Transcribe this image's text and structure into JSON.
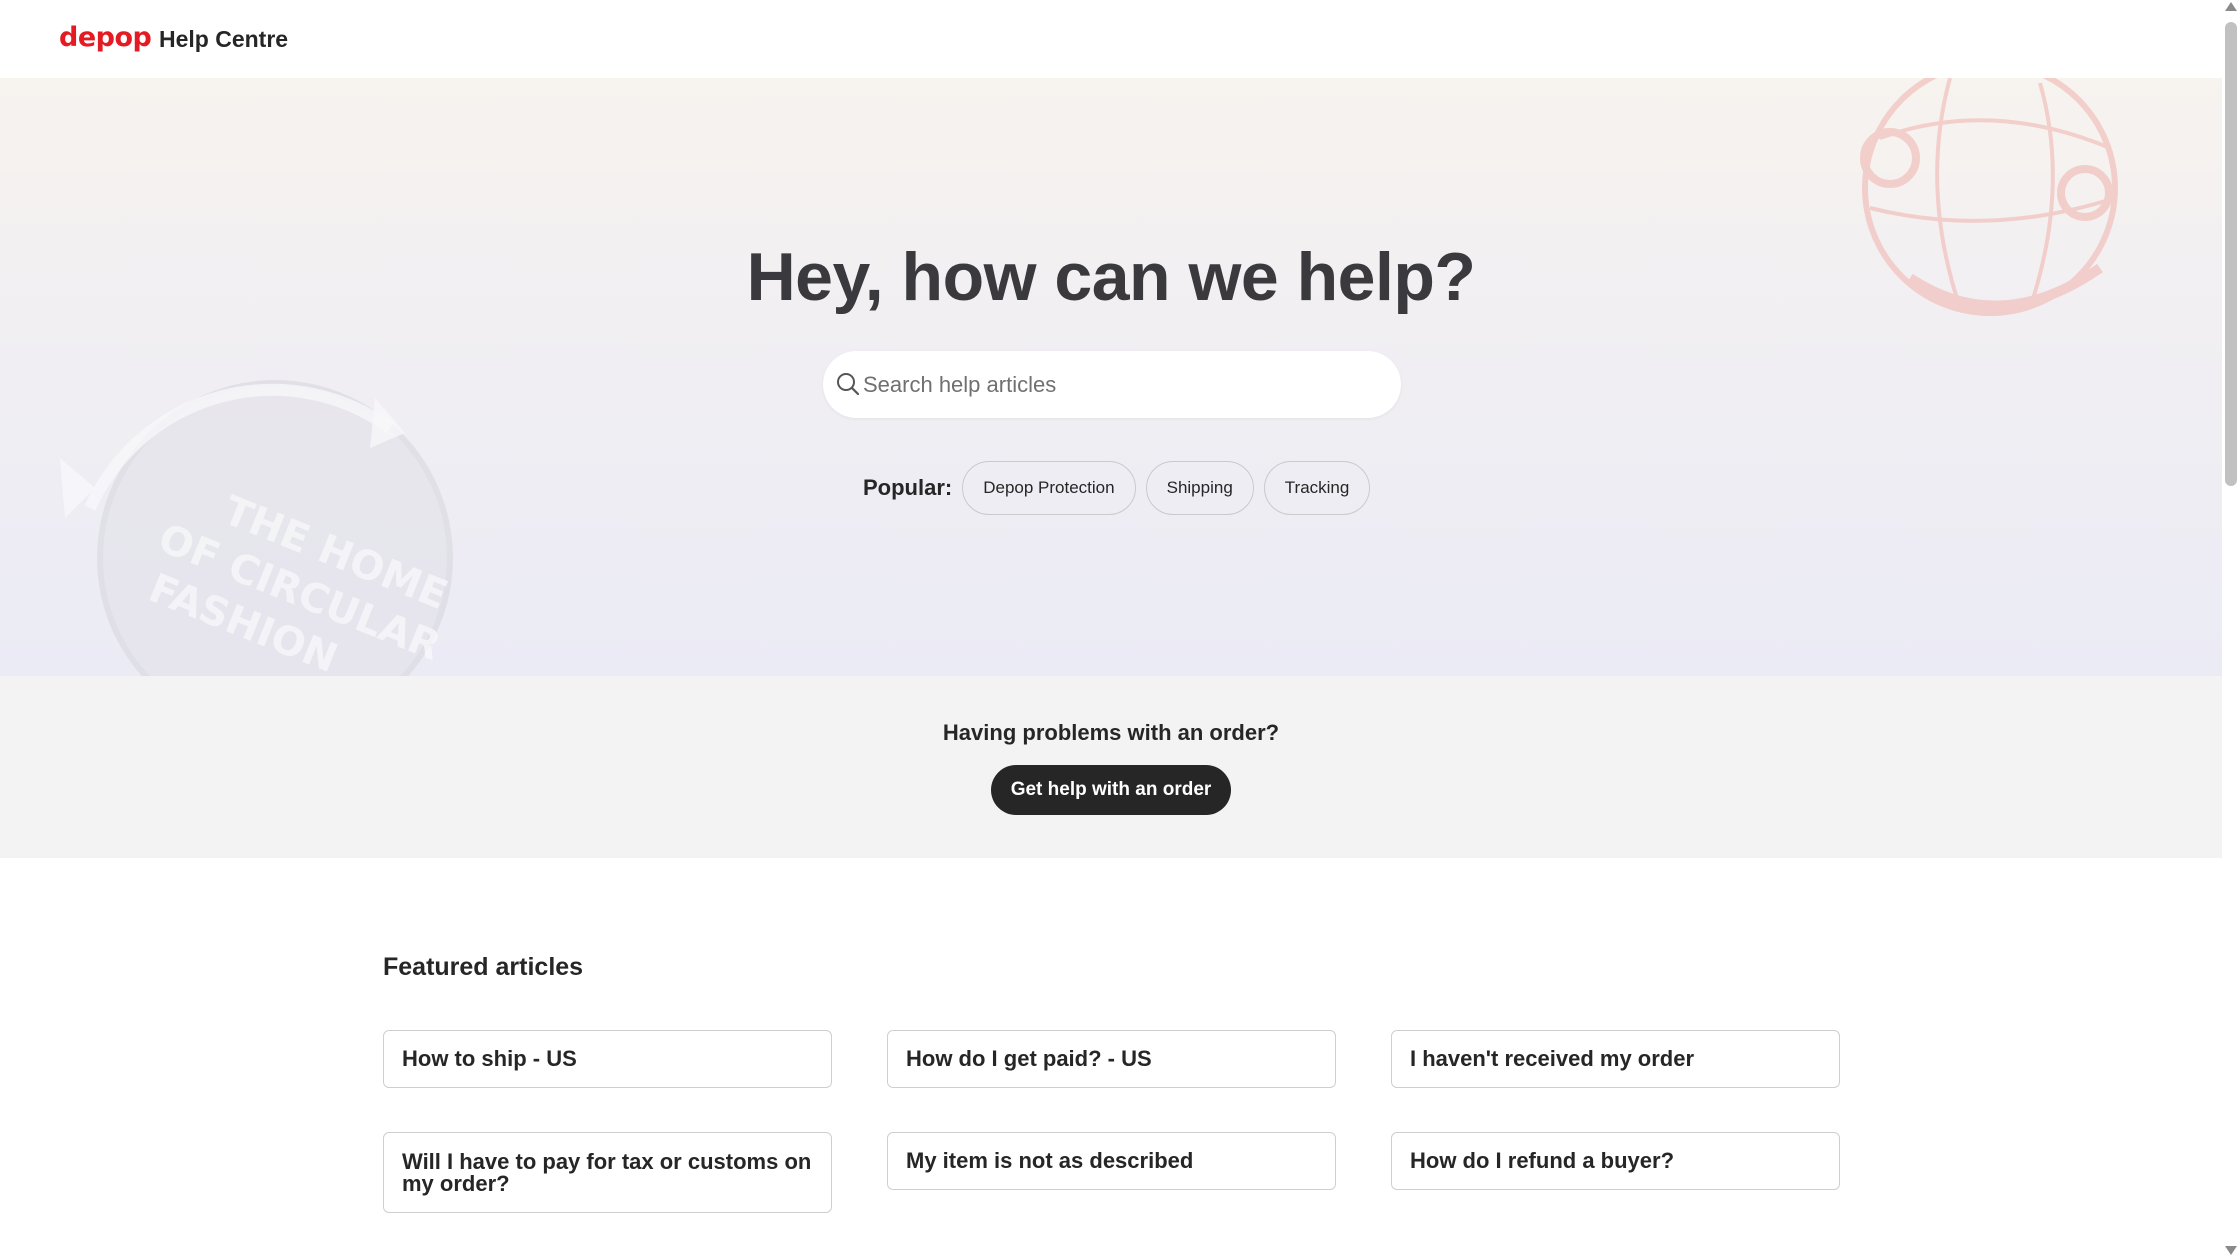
{
  "header": {
    "logo": "depop",
    "title": "Help Centre"
  },
  "hero": {
    "title": "Hey, how can we help?",
    "search": {
      "placeholder": "Search help articles",
      "value": ""
    },
    "popular_label": "Popular:",
    "popular_chips": [
      "Depop Protection",
      "Shipping",
      "Tracking"
    ]
  },
  "order_help": {
    "question": "Having problems with an order?",
    "button_label": "Get help with an order"
  },
  "featured": {
    "heading": "Featured articles",
    "articles": [
      "How to ship - US",
      "How do I get paid? - US",
      "I haven't received my order",
      "Will I have to pay for tax or customs on my order?",
      "My item is not as described",
      "How do I refund a buyer?"
    ]
  },
  "colors": {
    "brand_red": "#e41b23",
    "button_dark": "#262626",
    "band_grey": "#f3f3f3"
  },
  "icons": {
    "search": "search-icon",
    "scroll_up": "scroll-up-arrow-icon",
    "scroll_down": "scroll-down-arrow-icon"
  }
}
